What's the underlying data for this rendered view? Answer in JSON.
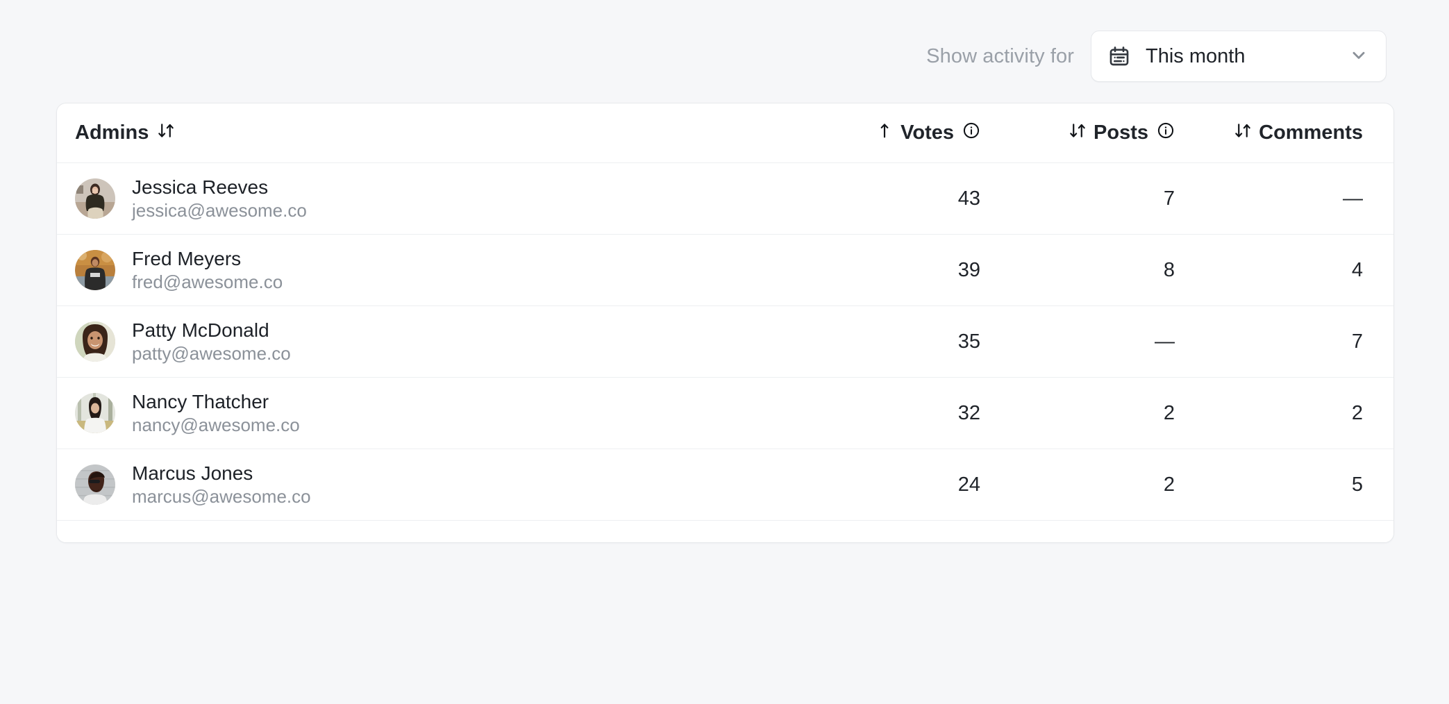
{
  "toolbar": {
    "label": "Show activity for",
    "period_value": "This month",
    "calendar_icon": "calendar-icon",
    "chevron_icon": "chevron-down-icon"
  },
  "table": {
    "columns": [
      {
        "key": "admins",
        "label": "Admins",
        "align": "left",
        "sort_icon": "sort-both-icon",
        "sort_state": "none",
        "has_info": false
      },
      {
        "key": "votes",
        "label": "Votes",
        "align": "right",
        "sort_icon": "sort-asc-icon",
        "sort_state": "asc",
        "has_info": true
      },
      {
        "key": "posts",
        "label": "Posts",
        "align": "right",
        "sort_icon": "sort-both-icon",
        "sort_state": "none",
        "has_info": true
      },
      {
        "key": "comments",
        "label": "Comments",
        "align": "right",
        "sort_icon": "sort-both-icon",
        "sort_state": "none",
        "has_info": false
      }
    ],
    "rows": [
      {
        "name": "Jessica Reeves",
        "email": "jessica@awesome.co",
        "votes": "43",
        "posts": "7",
        "comments": "—"
      },
      {
        "name": "Fred Meyers",
        "email": "fred@awesome.co",
        "votes": "39",
        "posts": "8",
        "comments": "4"
      },
      {
        "name": "Patty McDonald",
        "email": "patty@awesome.co",
        "votes": "35",
        "posts": "—",
        "comments": "7"
      },
      {
        "name": "Nancy Thatcher",
        "email": "nancy@awesome.co",
        "votes": "32",
        "posts": "2",
        "comments": "2"
      },
      {
        "name": "Marcus Jones",
        "email": "marcus@awesome.co",
        "votes": "24",
        "posts": "2",
        "comments": "5"
      }
    ]
  },
  "colors": {
    "page_background": "#f6f7f9",
    "card_background": "#ffffff",
    "border": "#e7e9ec",
    "row_divider": "#edeff1",
    "text_primary": "#1d2127",
    "text_muted": "#8b9199",
    "label_muted": "#9aa0a8"
  }
}
